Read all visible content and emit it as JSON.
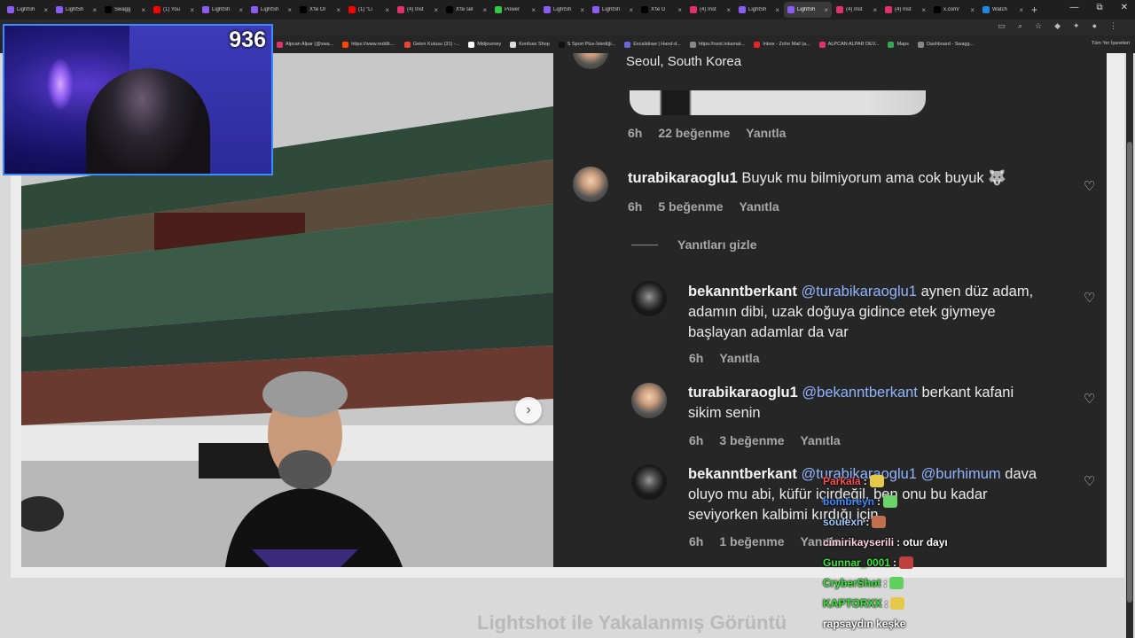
{
  "browser": {
    "tabs": [
      {
        "label": "LightSh",
        "color": "#8a5cf5"
      },
      {
        "label": "LightSh",
        "color": "#8a5cf5"
      },
      {
        "label": "Swagg",
        "color": "#000000"
      },
      {
        "label": "(1) You",
        "color": "#ff0000"
      },
      {
        "label": "LightSh",
        "color": "#8a5cf5"
      },
      {
        "label": "LightSh",
        "color": "#8a5cf5"
      },
      {
        "label": "X'te Ol",
        "color": "#000000"
      },
      {
        "label": "(1) \"Li",
        "color": "#ff0000"
      },
      {
        "label": "(4) Inst",
        "color": "#e1306c"
      },
      {
        "label": "X'te sel",
        "color": "#000000"
      },
      {
        "label": "Power",
        "color": "#2ecc40"
      },
      {
        "label": "LightSh",
        "color": "#8a5cf5"
      },
      {
        "label": "LightSh",
        "color": "#8a5cf5"
      },
      {
        "label": "X'te G",
        "color": "#000000"
      },
      {
        "label": "(4) Inst",
        "color": "#e1306c"
      },
      {
        "label": "LightSh",
        "color": "#8a5cf5"
      },
      {
        "label": "LightSh",
        "color": "#8a5cf5",
        "active": true
      },
      {
        "label": "(4) Inst",
        "color": "#e1306c"
      },
      {
        "label": "(4) Inst",
        "color": "#e1306c"
      },
      {
        "label": "x.com/",
        "color": "#000000"
      },
      {
        "label": "Watch",
        "color": "#1e88e5"
      }
    ],
    "new_tab": "+",
    "window_controls": [
      "—",
      "⧉",
      "✕"
    ],
    "bookmarks": [
      {
        "label": "Alpcan Alpar (@swa...",
        "color": "#e1306c"
      },
      {
        "label": "https://www.reddit....",
        "color": "#ff4500"
      },
      {
        "label": "Gelen Kutusu (31) -...",
        "color": "#ea4335"
      },
      {
        "label": "Midjourney",
        "color": "#ffffff"
      },
      {
        "label": "Konfuse Shop",
        "color": "#dddddd"
      },
      {
        "label": "S Sport Plus-İstediği...",
        "color": "#111111"
      },
      {
        "label": "Excalidraw | Hand-d...",
        "color": "#6965db"
      },
      {
        "label": "https://next.inkamat...",
        "color": "#888888"
      },
      {
        "label": "Inbox - Zoho Mail (a...",
        "color": "#e42527"
      },
      {
        "label": "ALPCAN ALPAR DEV...",
        "color": "#e1306c"
      },
      {
        "label": "Maps",
        "color": "#34a853"
      },
      {
        "label": "Dashboard - Swagg...",
        "color": "#888888"
      }
    ],
    "all_bookmarks": "Tüm Yer İşaretleri"
  },
  "stream": {
    "viewer_count": "936",
    "footer_text": "Lightshot ile Yakalanmış Görüntü"
  },
  "post": {
    "location": "Seoul, South Korea",
    "colors": {
      "accent": "#8fb4ff",
      "panel": "#262626"
    },
    "top_meta": {
      "time": "6h",
      "likes": "22 beğenme",
      "reply": "Yanıtla"
    },
    "comments": [
      {
        "username": "turabikaraoglu1",
        "text": "Buyuk mu bilmiyorum ama cok buyuk 🐺",
        "time": "6h",
        "likes": "5 beğenme",
        "reply": "Yanıtla"
      }
    ],
    "hide_replies": "Yanıtları gizle",
    "replies": [
      {
        "username": "bekanntberkant",
        "mention": "@turabikaraoglu1",
        "text": "aynen düz adam,",
        "line2": "adamın dibi, uzak doğuya gidince etek giymeye",
        "line3": "başlayan adamlar da var",
        "time": "6h",
        "reply": "Yanıtla"
      },
      {
        "username": "turabikaraoglu1",
        "mention": "@bekanntberkant",
        "text": "berkant kafani",
        "line2": "sikim senin",
        "time": "6h",
        "likes": "3 beğenme",
        "reply": "Yanıtla"
      },
      {
        "username": "bekanntberkant",
        "mention": "@turabikaraoglu1",
        "mention2": "@burhimum",
        "text": "dava",
        "line2": "oluyo mu abi, küfür içirdeğil, ben onu bu kadar",
        "line3": "seviyorken kalbimi kırdığı için",
        "time": "6h",
        "likes": "1 beğenme",
        "reply": "Yanıtla"
      }
    ]
  },
  "chat": [
    {
      "user": "Parkala",
      "color": "#ff4d4d",
      "msg": ""
    },
    {
      "user": "bombreyn",
      "color": "#3f8cff",
      "msg": ""
    },
    {
      "user": "soulexn",
      "color": "#9ec9ff",
      "msg": ""
    },
    {
      "user": "cimirikayserili",
      "color": "#ffd2e0",
      "msg": "otur dayı"
    },
    {
      "user": "Gunnar_0001",
      "color": "#39e639",
      "msg": ""
    },
    {
      "user": "CryberShot",
      "color": "#39e639",
      "msg": ""
    },
    {
      "user": "KAPTORXX",
      "color": "#39e639",
      "msg": ""
    },
    {
      "user": "",
      "color": "#ffffff",
      "msg": "rapsaydın keşke"
    }
  ]
}
